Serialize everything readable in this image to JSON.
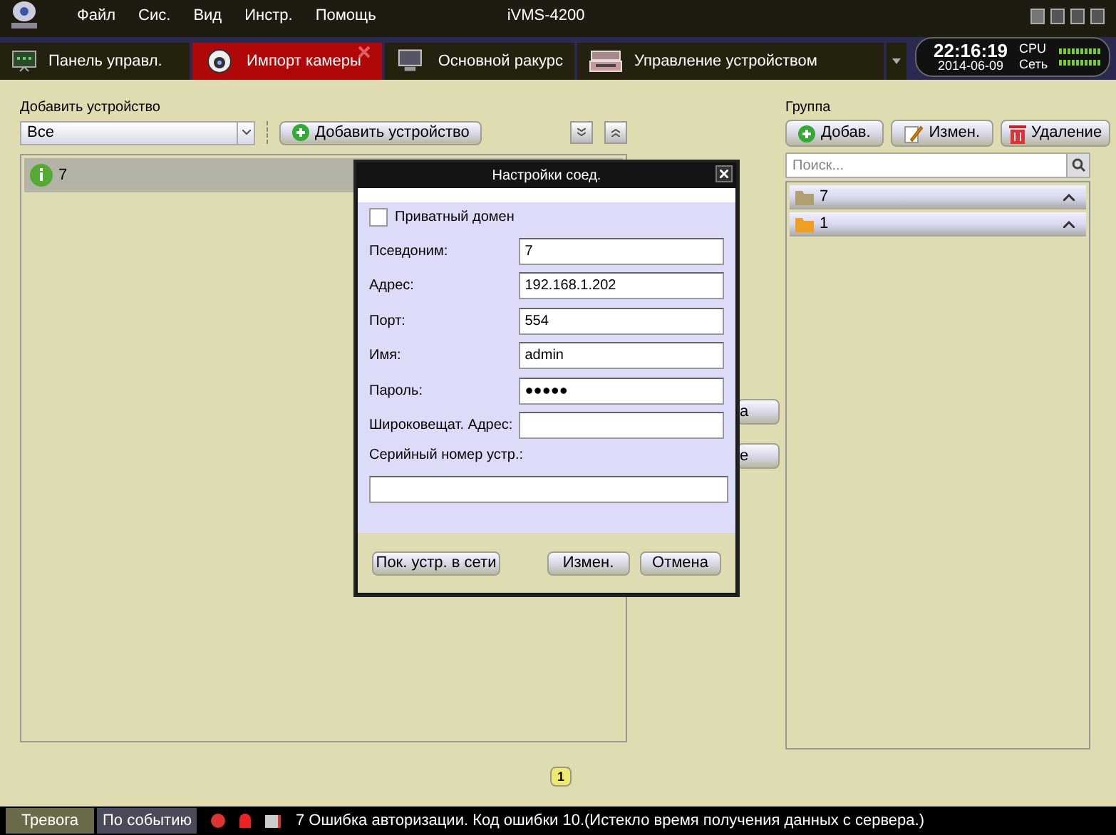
{
  "menu": [
    "Файл",
    "Сис.",
    "Вид",
    "Инстр.",
    "Помощь"
  ],
  "app_title": "iVMS-4200",
  "tabs": [
    {
      "label": "Панель управл.",
      "selected": false,
      "kind": "panel"
    },
    {
      "label": "Импорт камеры",
      "selected": true,
      "kind": "camera"
    },
    {
      "label": "Основной ракурс",
      "selected": false,
      "kind": "monitor"
    },
    {
      "label": "Управление устройством",
      "selected": false,
      "kind": "device"
    }
  ],
  "clock": {
    "time": "22:16:19",
    "date": "2014-06-09",
    "cpu_label": "CPU",
    "network_label": "Сеть"
  },
  "devices_panel": {
    "title": "Добавить устройство",
    "filter": "Все",
    "add_button": "Добавить устройство",
    "devices": [
      {
        "name": "7",
        "selected": true
      }
    ]
  },
  "middle_buttons": [
    "а",
    "е"
  ],
  "group_panel": {
    "title": "Группа",
    "buttons": [
      {
        "label": "Добав.",
        "kind": "add"
      },
      {
        "label": "Измен.",
        "kind": "edit"
      },
      {
        "label": "Удаление",
        "kind": "delete"
      }
    ],
    "search_placeholder": "Поиск...",
    "groups": [
      {
        "name": "7",
        "color": "#b0a070"
      },
      {
        "name": "1",
        "color": "#f0a020"
      }
    ]
  },
  "pagination": [
    {
      "label": "1",
      "selected": true
    }
  ],
  "dialog": {
    "title": "Настройки соед.",
    "private_domain": {
      "label": "Приватный домен",
      "checked": false
    },
    "fields": [
      {
        "label": "Псевдоним:",
        "value": "7"
      },
      {
        "label": "Адрес:",
        "value": "192.168.1.202"
      },
      {
        "label": "Порт:",
        "value": "554"
      },
      {
        "label": "Имя:",
        "value": "admin"
      },
      {
        "label": "Пароль:",
        "value": "●●●●●"
      },
      {
        "label": "Широковещат. Адрес:"
      }
    ],
    "serial_label": "Серийный номер устр.:",
    "buttons": [
      "Пок. устр. в сети",
      "Измен.",
      "Отмена"
    ]
  },
  "status_bar": {
    "tabs": [
      {
        "label": "Тревога",
        "selected": true
      },
      {
        "label": "По событию",
        "selected": false
      }
    ],
    "message": "7 Ошибка авторизации. Код ошибки 10.(Истекло время получения данных с сервера.)"
  }
}
